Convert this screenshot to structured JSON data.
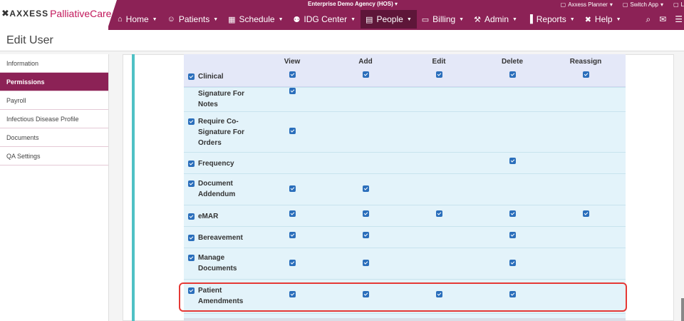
{
  "brand": {
    "mark": "✖",
    "name": "AXXESS",
    "product": "PalliativeCare"
  },
  "agency": {
    "name": "Enterprise Demo Agency (HOS)"
  },
  "top_links": [
    {
      "label": "Axxess Planner",
      "icon": "calendar-icon"
    },
    {
      "label": "Switch App",
      "icon": "external-link-icon"
    },
    {
      "label": "L",
      "icon": "lock-icon"
    }
  ],
  "nav": [
    {
      "label": "Home",
      "icon": "home-icon",
      "glyph": "⌂"
    },
    {
      "label": "Patients",
      "icon": "user-icon",
      "glyph": "☺"
    },
    {
      "label": "Schedule",
      "icon": "calendar-icon",
      "glyph": "▦"
    },
    {
      "label": "IDG Center",
      "icon": "group-icon",
      "glyph": "⚉"
    },
    {
      "label": "People",
      "icon": "id-card-icon",
      "glyph": "▤",
      "active": true
    },
    {
      "label": "Billing",
      "icon": "money-icon",
      "glyph": "▭"
    },
    {
      "label": "Admin",
      "icon": "wrench-icon",
      "glyph": "⚒"
    },
    {
      "label": "Reports",
      "icon": "bar-chart-icon",
      "glyph": "▐"
    },
    {
      "label": "Help",
      "icon": "help-icon",
      "glyph": "✖"
    }
  ],
  "nav_right": [
    {
      "icon": "search-icon",
      "glyph": "⌕"
    },
    {
      "icon": "mail-icon",
      "glyph": "✉"
    },
    {
      "icon": "menu-icon",
      "glyph": "☰"
    }
  ],
  "page": {
    "title": "Edit User"
  },
  "sidebar": {
    "items": [
      {
        "label": "Information"
      },
      {
        "label": "Permissions",
        "active": true
      },
      {
        "label": "Payroll"
      },
      {
        "label": "Infectious Disease Profile"
      },
      {
        "label": "Documents"
      },
      {
        "label": "QA Settings"
      }
    ]
  },
  "permissions": {
    "columns": [
      "View",
      "Add",
      "Edit",
      "Delete",
      "Reassign"
    ],
    "header_row": {
      "label": "Clinical",
      "checked": [
        true,
        true,
        true,
        true,
        true
      ]
    },
    "rows": [
      {
        "label": "Signature For Notes",
        "lines": [
          "Signature For",
          "Notes"
        ],
        "checked": [
          true,
          false,
          false,
          false,
          false
        ]
      },
      {
        "label": "Require Co-Signature For Orders",
        "lines": [
          "Require Co-",
          "Signature For",
          "Orders"
        ],
        "checked": [
          true,
          false,
          false,
          false,
          false
        ]
      },
      {
        "label": "Frequency",
        "lines": [
          "Frequency"
        ],
        "checked": [
          false,
          false,
          false,
          true,
          false
        ]
      },
      {
        "label": "Document Addendum",
        "lines": [
          "Document",
          "Addendum"
        ],
        "checked": [
          true,
          true,
          false,
          false,
          false
        ]
      },
      {
        "label": "eMAR",
        "lines": [
          "eMAR"
        ],
        "checked": [
          true,
          true,
          true,
          true,
          true
        ]
      },
      {
        "label": "Bereavement",
        "lines": [
          "Bereavement"
        ],
        "checked": [
          true,
          true,
          false,
          true,
          false
        ]
      },
      {
        "label": "Manage Documents",
        "lines": [
          "Manage",
          "Documents"
        ],
        "checked": [
          true,
          true,
          false,
          true,
          false
        ]
      },
      {
        "label": "Patient Amendments",
        "lines": [
          "Patient",
          "Amendments"
        ],
        "checked": [
          true,
          true,
          true,
          true,
          false
        ],
        "highlighted": true
      }
    ]
  },
  "colors": {
    "brand": "#8c2256",
    "accent": "#c2185b",
    "checkbox": "#2a6ebb",
    "highlight": "#e53935",
    "teal": "#4fc1c5"
  }
}
